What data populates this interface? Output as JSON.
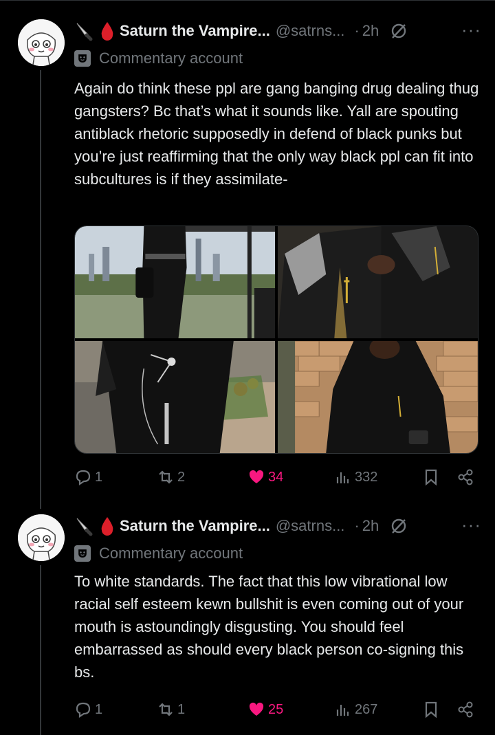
{
  "tweets": [
    {
      "emoji_icons": [
        "knife-icon",
        "blood-drop-icon"
      ],
      "display_name": "Saturn the Vampire...",
      "handle": "@satrns...",
      "separator": "·",
      "time": "2h",
      "label": "Commentary account",
      "text": "Again do think these ppl are gang banging drug dealing thug gangsters? Bc that’s what it sounds like. Yall are spouting antiblack rhetoric supposedly in defend of black punks but you’re just reaffirming that the only way black ppl can fit into subcultures is if they assimilate-",
      "media_count": 4,
      "stats": {
        "replies": "1",
        "reposts": "2",
        "likes": "34",
        "views": "332"
      }
    },
    {
      "emoji_icons": [
        "knife-icon",
        "blood-drop-icon"
      ],
      "display_name": "Saturn the Vampire...",
      "handle": "@satrns...",
      "separator": "·",
      "time": "2h",
      "label": "Commentary account",
      "text": "To white standards. The fact that this low vibrational low racial self esteem kewn bullshit is even coming out of your mouth is astoundingly disgusting. You should feel embarrassed as should every black person co-signing this bs.",
      "stats": {
        "replies": "1",
        "reposts": "1",
        "likes": "25",
        "views": "267"
      }
    }
  ],
  "colors": {
    "background": "#000000",
    "text": "#e7e9ea",
    "muted": "#71767b",
    "like": "#f91880",
    "divider": "#2f3336"
  }
}
